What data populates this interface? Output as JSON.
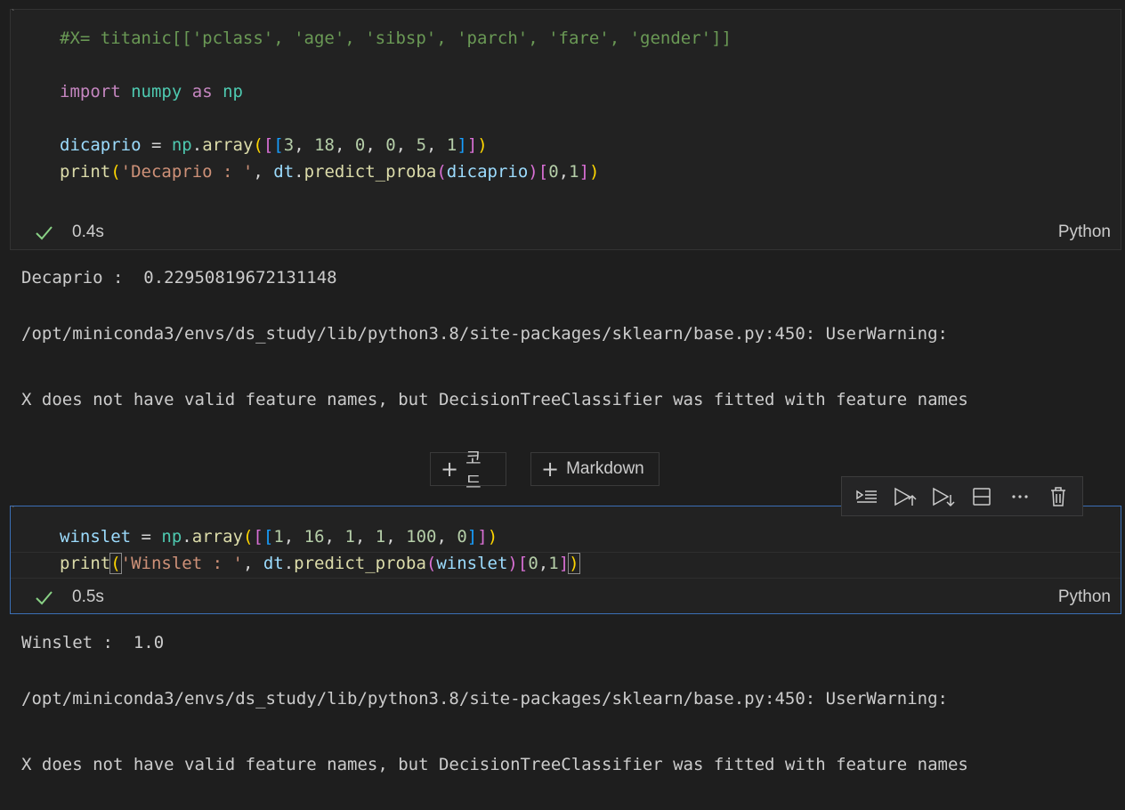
{
  "cell1": {
    "lines": [
      [
        {
          "t": "#X= titanic[['pclass', 'age', 'sibsp', 'parch', 'fare', 'gender']]",
          "c": "cm"
        }
      ],
      [],
      [
        {
          "t": "import",
          "c": "kw"
        },
        {
          "t": " ",
          "c": "def"
        },
        {
          "t": "numpy",
          "c": "mod"
        },
        {
          "t": " ",
          "c": "def"
        },
        {
          "t": "as",
          "c": "kw"
        },
        {
          "t": " ",
          "c": "def"
        },
        {
          "t": "np",
          "c": "mod"
        }
      ],
      [],
      [
        {
          "t": "dicaprio",
          "c": "var"
        },
        {
          "t": " = ",
          "c": "def"
        },
        {
          "t": "np",
          "c": "mod"
        },
        {
          "t": ".",
          "c": "def"
        },
        {
          "t": "array",
          "c": "fn"
        },
        {
          "t": "(",
          "c": "b1"
        },
        {
          "t": "[",
          "c": "b2"
        },
        {
          "t": "[",
          "c": "b3"
        },
        {
          "t": "3",
          "c": "num"
        },
        {
          "t": ", ",
          "c": "def"
        },
        {
          "t": "18",
          "c": "num"
        },
        {
          "t": ", ",
          "c": "def"
        },
        {
          "t": "0",
          "c": "num"
        },
        {
          "t": ", ",
          "c": "def"
        },
        {
          "t": "0",
          "c": "num"
        },
        {
          "t": ", ",
          "c": "def"
        },
        {
          "t": "5",
          "c": "num"
        },
        {
          "t": ", ",
          "c": "def"
        },
        {
          "t": "1",
          "c": "num"
        },
        {
          "t": "]",
          "c": "b3"
        },
        {
          "t": "]",
          "c": "b2"
        },
        {
          "t": ")",
          "c": "b1"
        }
      ],
      [
        {
          "t": "print",
          "c": "fn"
        },
        {
          "t": "(",
          "c": "b1"
        },
        {
          "t": "'Decaprio : '",
          "c": "str"
        },
        {
          "t": ", ",
          "c": "def"
        },
        {
          "t": "dt",
          "c": "var"
        },
        {
          "t": ".",
          "c": "def"
        },
        {
          "t": "predict_proba",
          "c": "fn"
        },
        {
          "t": "(",
          "c": "b2"
        },
        {
          "t": "dicaprio",
          "c": "var"
        },
        {
          "t": ")",
          "c": "b2"
        },
        {
          "t": "[",
          "c": "b2"
        },
        {
          "t": "0",
          "c": "num"
        },
        {
          "t": ",",
          "c": "def"
        },
        {
          "t": "1",
          "c": "num"
        },
        {
          "t": "]",
          "c": "b2"
        },
        {
          "t": ")",
          "c": "b1"
        }
      ]
    ],
    "time": "0.4s",
    "lang": "Python",
    "output": [
      "Decaprio :  0.22950819672131148",
      "/opt/miniconda3/envs/ds_study/lib/python3.8/site-packages/sklearn/base.py:450: UserWarning:",
      "X does not have valid feature names, but DecisionTreeClassifier was fitted with feature names"
    ]
  },
  "add_buttons": {
    "code_label": "코드",
    "markdown_label": "Markdown"
  },
  "toolbar": {
    "icons": [
      "run-by-line-icon",
      "execute-above-icon",
      "execute-below-icon",
      "split-cell-icon",
      "more-icon",
      "delete-icon"
    ]
  },
  "cell2": {
    "lines": [
      [
        {
          "t": "winslet",
          "c": "var"
        },
        {
          "t": " = ",
          "c": "def"
        },
        {
          "t": "np",
          "c": "mod"
        },
        {
          "t": ".",
          "c": "def"
        },
        {
          "t": "array",
          "c": "fn"
        },
        {
          "t": "(",
          "c": "b1"
        },
        {
          "t": "[",
          "c": "b2"
        },
        {
          "t": "[",
          "c": "b3"
        },
        {
          "t": "1",
          "c": "num"
        },
        {
          "t": ", ",
          "c": "def"
        },
        {
          "t": "16",
          "c": "num"
        },
        {
          "t": ", ",
          "c": "def"
        },
        {
          "t": "1",
          "c": "num"
        },
        {
          "t": ", ",
          "c": "def"
        },
        {
          "t": "1",
          "c": "num"
        },
        {
          "t": ", ",
          "c": "def"
        },
        {
          "t": "100",
          "c": "num"
        },
        {
          "t": ", ",
          "c": "def"
        },
        {
          "t": "0",
          "c": "num"
        },
        {
          "t": "]",
          "c": "b3"
        },
        {
          "t": "]",
          "c": "b2"
        },
        {
          "t": ")",
          "c": "b1"
        }
      ],
      [
        {
          "t": "print",
          "c": "fn"
        },
        {
          "t": "(",
          "c": "b1 bm"
        },
        {
          "t": "'Winslet : '",
          "c": "str"
        },
        {
          "t": ", ",
          "c": "def"
        },
        {
          "t": "dt",
          "c": "var"
        },
        {
          "t": ".",
          "c": "def"
        },
        {
          "t": "predict_proba",
          "c": "fn"
        },
        {
          "t": "(",
          "c": "b2"
        },
        {
          "t": "winslet",
          "c": "var"
        },
        {
          "t": ")",
          "c": "b2"
        },
        {
          "t": "[",
          "c": "b2"
        },
        {
          "t": "0",
          "c": "num"
        },
        {
          "t": ",",
          "c": "def"
        },
        {
          "t": "1",
          "c": "num"
        },
        {
          "t": "]",
          "c": "b2"
        },
        {
          "t": ")",
          "c": "b1 bm"
        }
      ]
    ],
    "time": "0.5s",
    "lang": "Python",
    "output": [
      "Winslet :  1.0",
      "/opt/miniconda3/envs/ds_study/lib/python3.8/site-packages/sklearn/base.py:450: UserWarning:",
      "X does not have valid feature names, but DecisionTreeClassifier was fitted with feature names"
    ]
  },
  "colors": {
    "background": "#1e1e1e",
    "cell_background": "#222222",
    "selected_border": "#3b6fb6",
    "success_check": "#89d185"
  }
}
